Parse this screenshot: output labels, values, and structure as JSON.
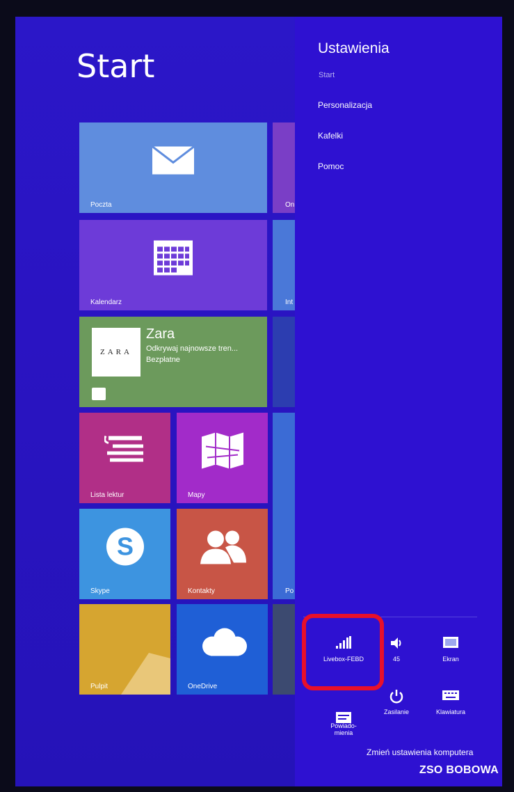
{
  "start": {
    "title": "Start"
  },
  "tiles": {
    "mail": "Poczta",
    "calendar": "Kalendarz",
    "zara": {
      "name": "Zara",
      "description": "Odkrywaj najnowsze tren...",
      "price": "Bezpłatne",
      "logo_text": "ZARA"
    },
    "reading_list": "Lista lektur",
    "maps": "Mapy",
    "skype": "Skype",
    "contacts": "Kontakty",
    "desktop": "Pulpit",
    "onedrive": "OneDrive",
    "partial_1": "On",
    "partial_2": "Int",
    "partial_4": "Po"
  },
  "settings": {
    "title": "Ustawienia",
    "context": "Start",
    "links": [
      "Personalizacja",
      "Kafelki",
      "Pomoc"
    ],
    "quick": {
      "network": "Livebox-FEBD",
      "volume": "45",
      "screen": "Ekran",
      "notifications": "Powiado-\nmienia",
      "power": "Zasilanie",
      "keyboard": "Klawiatura"
    },
    "change_pc_settings": "Zmień ustawienia komputera"
  },
  "watermark": "ZSO BOBOWA",
  "colors": {
    "accent": "#2e11d1",
    "highlight": "#e8102a"
  }
}
